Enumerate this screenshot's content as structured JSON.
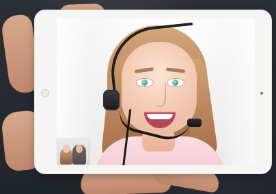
{
  "scene": {
    "subject": "video-call-on-tablet"
  },
  "icons": {
    "tablet_home_button": "home-button-icon",
    "tablet_camera": "camera-icon",
    "headset": "headset-icon",
    "picture_in_picture": "picture-in-picture-icon"
  },
  "colors": {
    "tablet_frame": "#f5f5f3",
    "screen_background": "#ecebea",
    "headset": "#17181b",
    "shirt": "#fbdde2",
    "hair": "#c89563"
  }
}
